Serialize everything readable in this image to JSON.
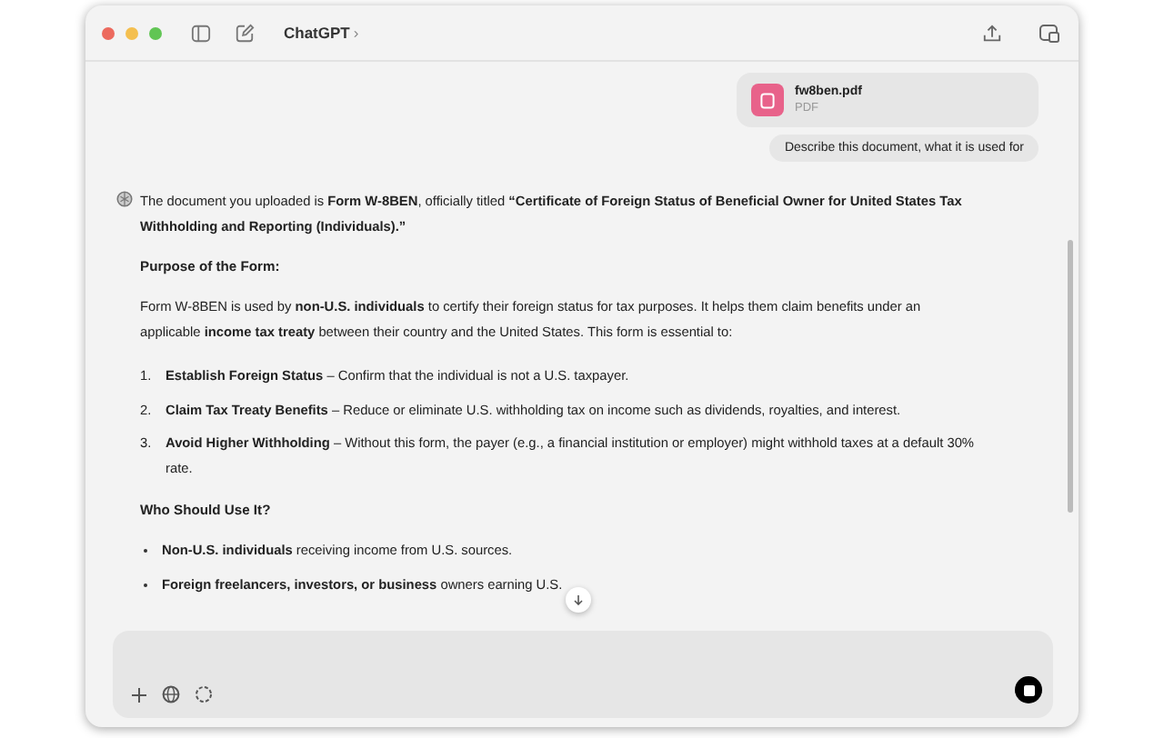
{
  "window": {
    "title": "ChatGPT",
    "title_caret": "›"
  },
  "attachment": {
    "name": "fw8ben.pdf",
    "type": "PDF"
  },
  "user_message": "Describe this document, what it is used for",
  "response": [
    {
      "kind": "paragraph",
      "text": "The document you uploaded is **Form W-8BEN**, officially titled **“Certificate of Foreign Status of Beneficial Owner for United States Tax Withholding and Reporting (Individuals).”**"
    },
    {
      "kind": "heading",
      "text": "Purpose of the Form:"
    },
    {
      "kind": "paragraph",
      "text": "Form W-8BEN is used by **non-U.S. individuals** to certify their foreign status for tax purposes. It helps them claim benefits under an applicable **income tax treaty** between their country and the United States. This form is essential to:"
    },
    {
      "kind": "numbered",
      "items": [
        {
          "number": "1.",
          "text": "**Establish Foreign Status** – Confirm that the individual is not a U.S. taxpayer."
        },
        {
          "number": "2.",
          "text": "**Claim Tax Treaty Benefits** – Reduce or eliminate U.S. withholding tax on income such as dividends, royalties, and interest."
        },
        {
          "number": "3.",
          "text": "**Avoid Higher Withholding** – Without this form, the payer (e.g., a financial institution or employer) might withhold taxes at a default 30% rate."
        }
      ]
    },
    {
      "kind": "heading",
      "text": "Who Should Use It?"
    },
    {
      "kind": "bullets",
      "items": [
        {
          "text": "**Non-U.S. individuals** receiving income from U.S. sources."
        },
        {
          "text": "**Foreign freelancers, investors, or business** owners earning U.S."
        }
      ]
    }
  ]
}
